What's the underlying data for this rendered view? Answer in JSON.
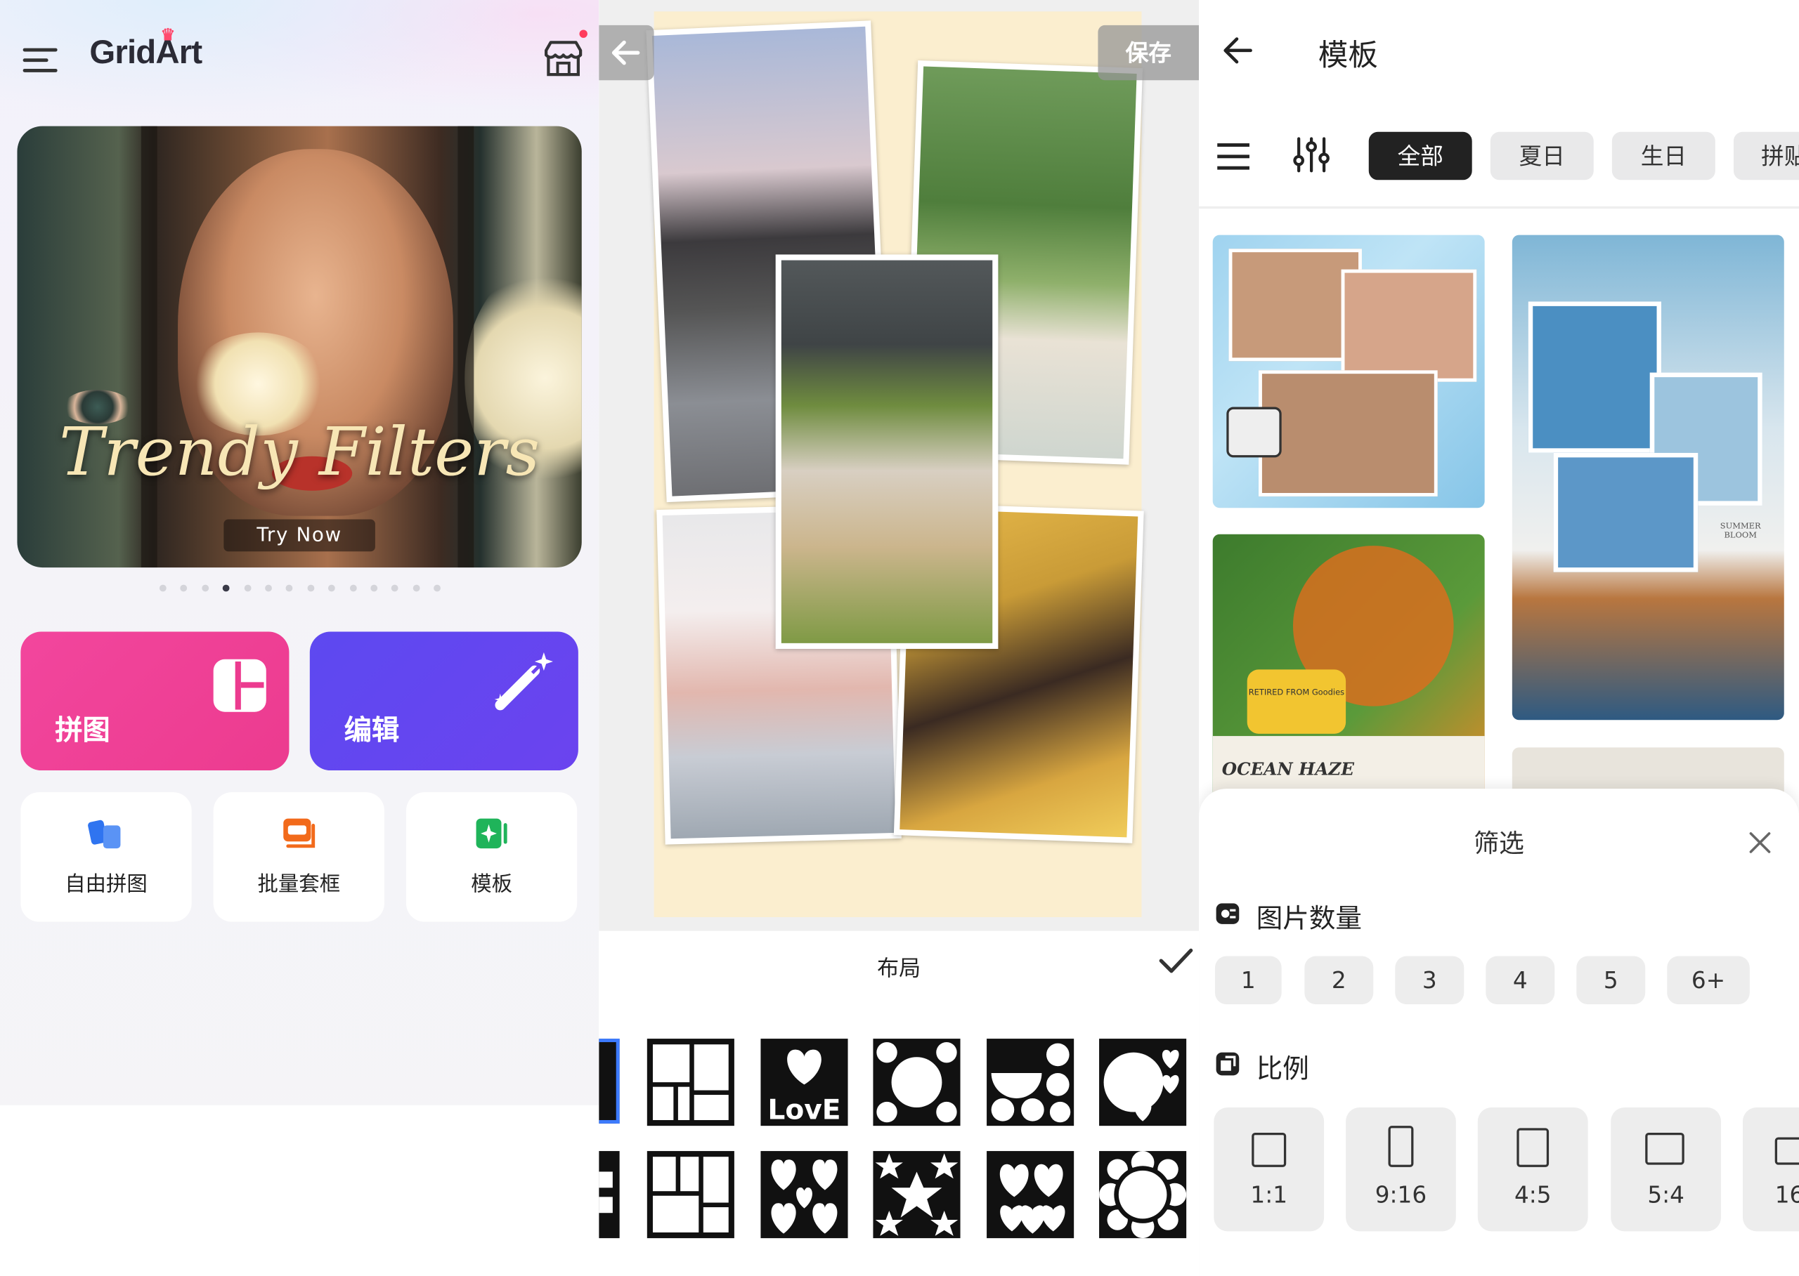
{
  "home": {
    "app_name": "GridArt",
    "banner": {
      "title": "Trendy Filters",
      "cta": "Try Now"
    },
    "carousel": {
      "count": 14,
      "active_index": 3
    },
    "actions": [
      {
        "label": "拼图",
        "icon": "collage-grid-icon",
        "color": "#ee3f94"
      },
      {
        "label": "编辑",
        "icon": "magic-wand-icon",
        "color": "#5f47f0"
      }
    ],
    "tools": [
      {
        "label": "自由拼图",
        "icon": "free-collage-icon"
      },
      {
        "label": "批量套框",
        "icon": "batch-frame-icon"
      },
      {
        "label": "模板",
        "icon": "template-icon"
      }
    ]
  },
  "editor": {
    "save_label": "保存",
    "layout_title": "布局",
    "canvas_color": "#fbeecf",
    "layouts": [
      "grid-layout-icon",
      "love-text-layout-icon",
      "circles-layout-icon",
      "semicircle-layout-icon",
      "hearts-layout-icon",
      "grid-layout-icon",
      "hearts-cluster-layout-icon",
      "stars-layout-icon",
      "heart-bunch-layout-icon",
      "flower-circle-layout-icon"
    ]
  },
  "templates": {
    "title": "模板",
    "categories": [
      "全部",
      "夏日",
      "生日",
      "拼贴"
    ],
    "active_category": "全部",
    "card_captions": {
      "ocean": "OCEAN HAZE",
      "summer": "SUMMER BLOOM",
      "sticker": "RETIRED FROM Goodies"
    },
    "filter_sheet": {
      "title": "筛选",
      "photo_count_label": "图片数量",
      "photo_counts": [
        "1",
        "2",
        "3",
        "4",
        "5",
        "6+"
      ],
      "ratio_label": "比例",
      "ratios": [
        "1:1",
        "9:16",
        "4:5",
        "5:4",
        "16"
      ]
    }
  }
}
